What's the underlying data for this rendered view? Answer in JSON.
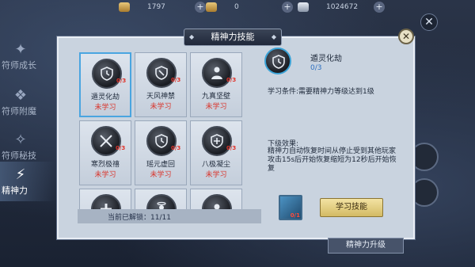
{
  "currencies": [
    {
      "value": "1797",
      "icon": "gold-ingot-icon"
    },
    {
      "value": "0",
      "icon": "gold-ingot-icon"
    },
    {
      "value": "1024672",
      "icon": "silver-coin-icon"
    }
  ],
  "nav": {
    "items": [
      {
        "label": "符师成长",
        "icon": "growth-icon"
      },
      {
        "label": "符师附魔",
        "icon": "enchant-icon"
      },
      {
        "label": "符师秘技",
        "icon": "secret-skill-icon"
      },
      {
        "label": "精神力",
        "icon": "spirit-icon",
        "active": true
      }
    ]
  },
  "panel": {
    "title": "精神力技能",
    "close_glyph": "✕"
  },
  "skills": [
    {
      "name": "遁灵化劫",
      "status": "未学习",
      "level": "0/3",
      "icon": "clock-shield-icon",
      "selected": true
    },
    {
      "name": "天风神禁",
      "status": "未学习",
      "level": "0/3",
      "icon": "shield-icon"
    },
    {
      "name": "九真坚壁",
      "status": "未学习",
      "level": "0/3",
      "icon": "guardian-icon"
    },
    {
      "name": "寒烈极禧",
      "status": "未学习",
      "level": "0/3",
      "icon": "crossed-swords-icon"
    },
    {
      "name": "瑶元虚回",
      "status": "未学习",
      "level": "0/3",
      "icon": "clock-shield-icon"
    },
    {
      "name": "八极凝尘",
      "status": "未学习",
      "level": "0/3",
      "icon": "plus-shield-icon"
    },
    {
      "name": "",
      "status": "",
      "level": "",
      "icon": "cross-icon"
    },
    {
      "name": "",
      "status": "",
      "level": "",
      "icon": "halo-figure-icon"
    },
    {
      "name": "",
      "status": "",
      "level": "",
      "icon": "figure-icon"
    }
  ],
  "unlock": {
    "text": "当前已解锁：11/11"
  },
  "detail": {
    "name": "遁灵化劫",
    "progress": "0/3",
    "condition": "学习条件:需要精神力等级达到1级",
    "effect_title": "下级效果:",
    "effect_text": "精神力自动恢复时间从停止受到其他玩家攻击15s后开始恢复缩短为12秒后开始恢复",
    "book_count": "0/1",
    "learn_button": "学习技能"
  },
  "upgrade_tab": "精神力升级",
  "colors": {
    "accent_red": "#d9342b",
    "accent_blue": "#2d6fc0",
    "button_gold": "#d3ba64"
  }
}
